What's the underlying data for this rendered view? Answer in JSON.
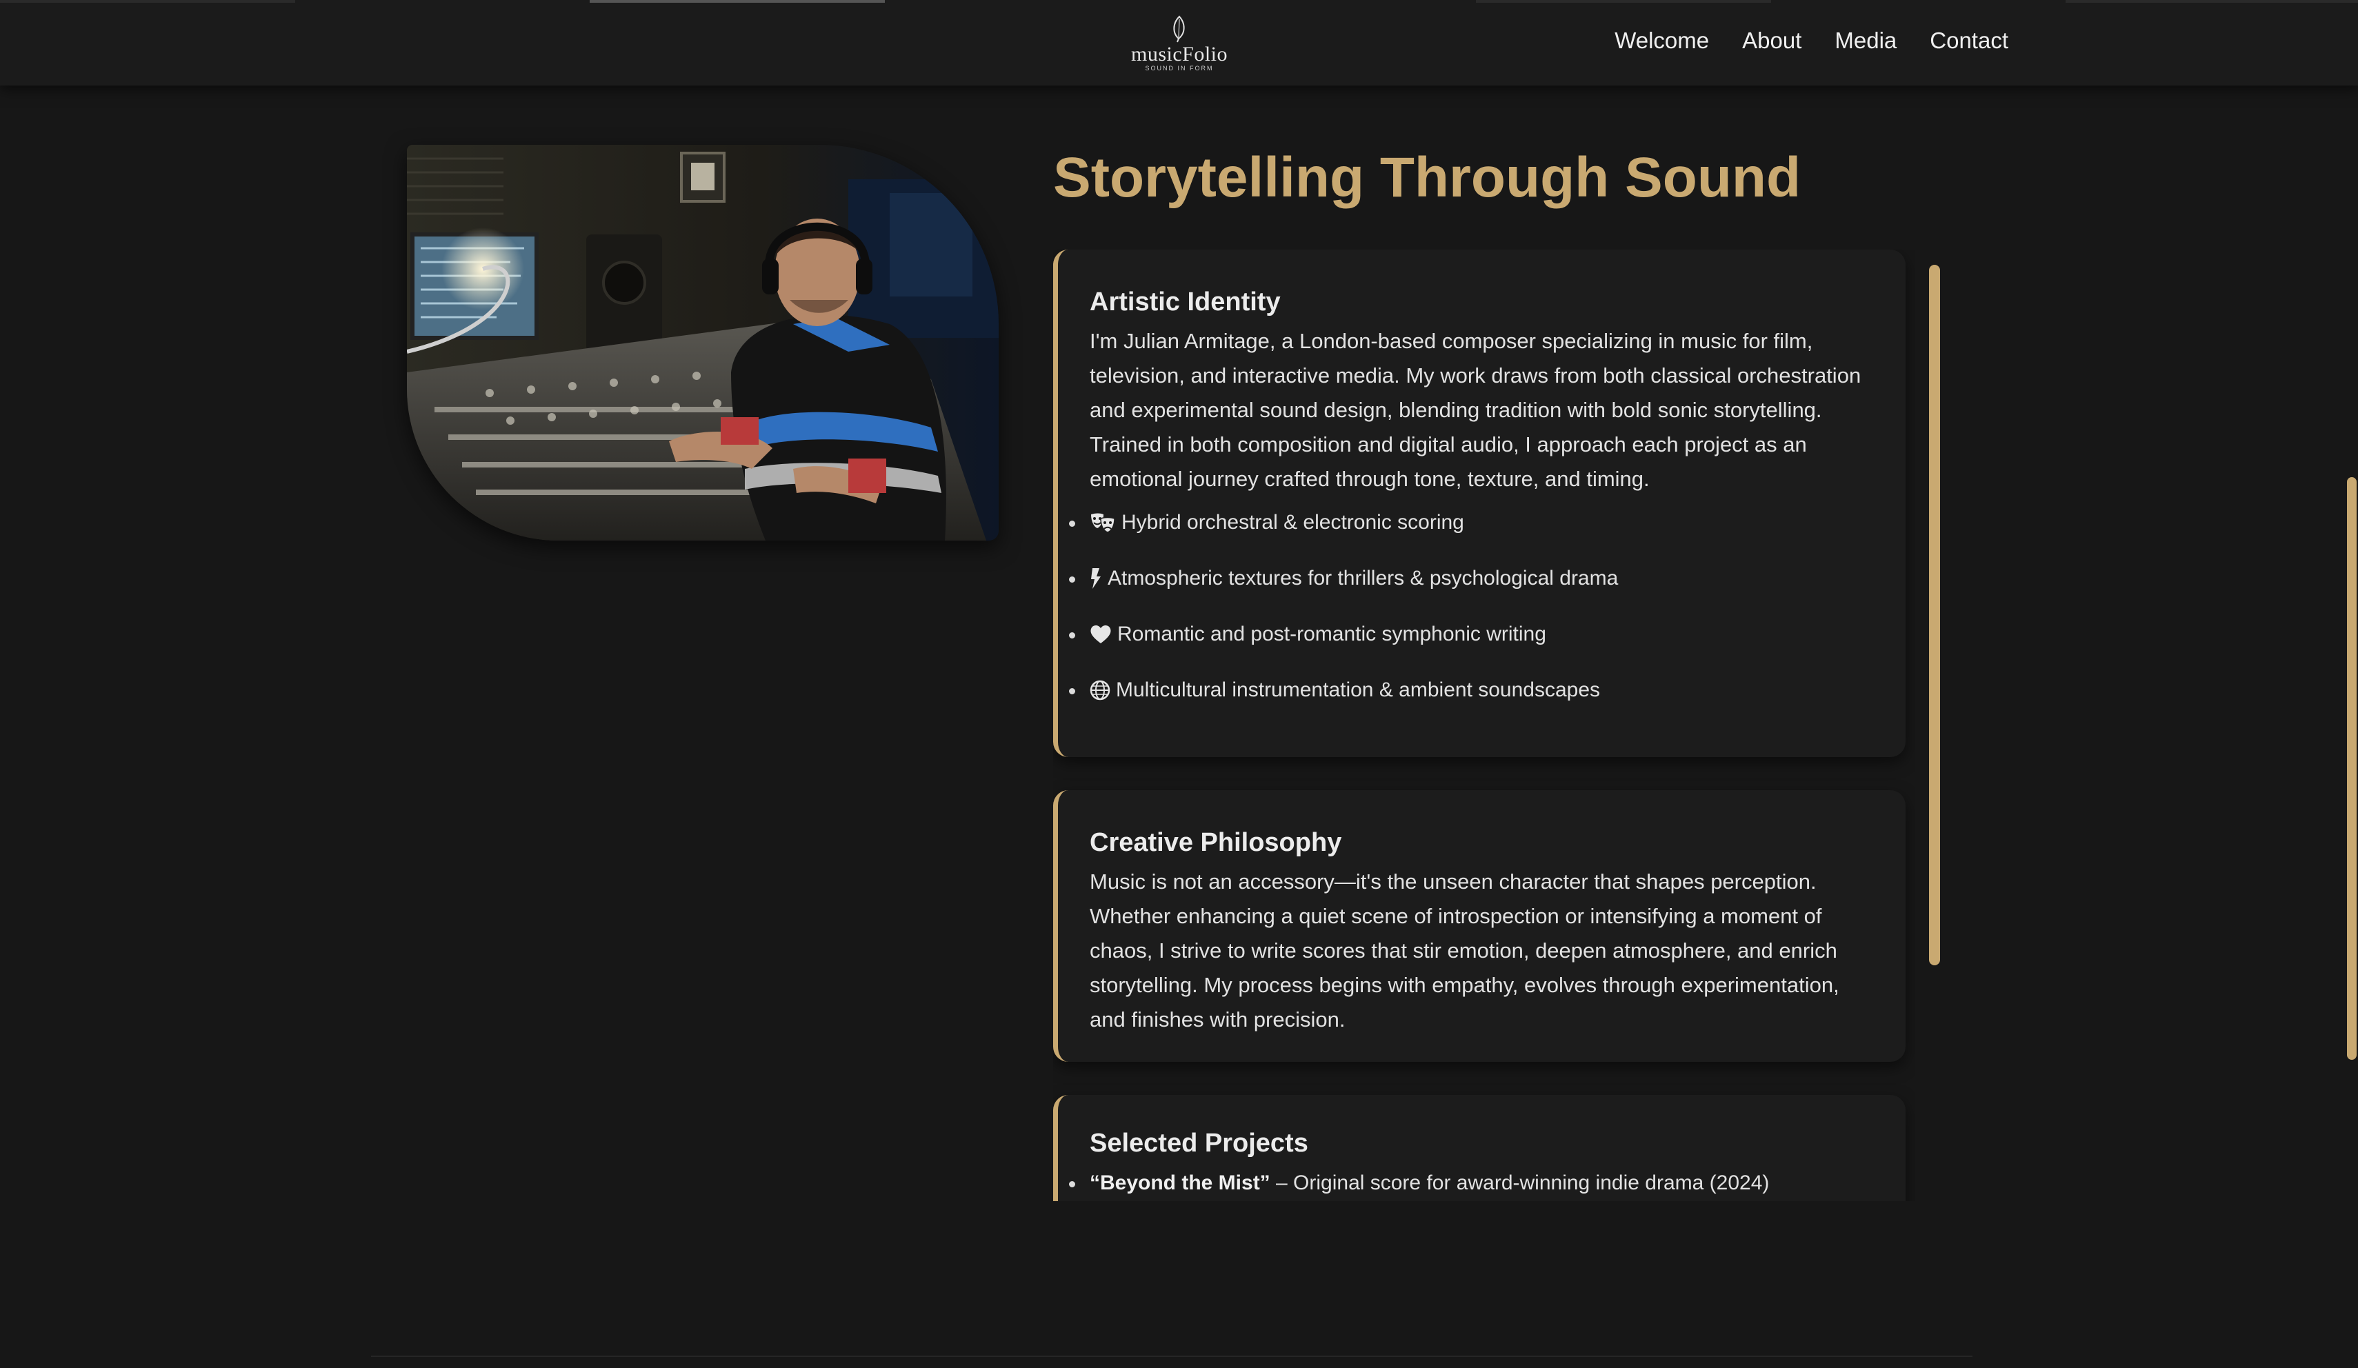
{
  "brand": {
    "name": "musicFolio",
    "tagline": "SOUND IN FORM",
    "icon": "leaf-icon"
  },
  "nav": {
    "items": [
      {
        "label": "Welcome"
      },
      {
        "label": "About"
      },
      {
        "label": "Media"
      },
      {
        "label": "Contact"
      }
    ]
  },
  "hero": {
    "photo_subject": "composer-at-mixing-console-photo"
  },
  "headline": "Storytelling Through Sound",
  "sections": {
    "identity": {
      "title": "Artistic Identity",
      "body": "I'm Julian Armitage, a London-based composer specializing in music for film, television, and interactive media. My work draws from both classical orchestration and experimental sound design, blending tradition with bold sonic storytelling. Trained in both composition and digital audio, I approach each project as an emotional journey crafted through tone, texture, and timing.",
      "bullets": [
        {
          "icon": "theater-masks-icon",
          "text": "Hybrid orchestral & electronic scoring"
        },
        {
          "icon": "bolt-icon",
          "text": "Atmospheric textures for thrillers & psychological drama"
        },
        {
          "icon": "heart-icon",
          "text": "Romantic and post-romantic symphonic writing"
        },
        {
          "icon": "globe-icon",
          "text": "Multicultural instrumentation & ambient soundscapes"
        }
      ]
    },
    "philosophy": {
      "title": "Creative Philosophy",
      "body": "Music is not an accessory—it's the unseen character that shapes perception. Whether enhancing a quiet scene of introspection or intensifying a moment of chaos, I strive to write scores that stir emotion, deepen atmosphere, and enrich storytelling. My process begins with empathy, evolves through experimentation, and finishes with precision."
    },
    "projects": {
      "title": "Selected Projects",
      "items": [
        {
          "name": "“Beyond the Mist”",
          "desc": " – Original score for award-winning indie drama (2024)"
        }
      ]
    }
  },
  "colors": {
    "accent": "#c9a971",
    "background": "#171717",
    "card": "#1c1c1c",
    "text": "#e2e2e2"
  }
}
